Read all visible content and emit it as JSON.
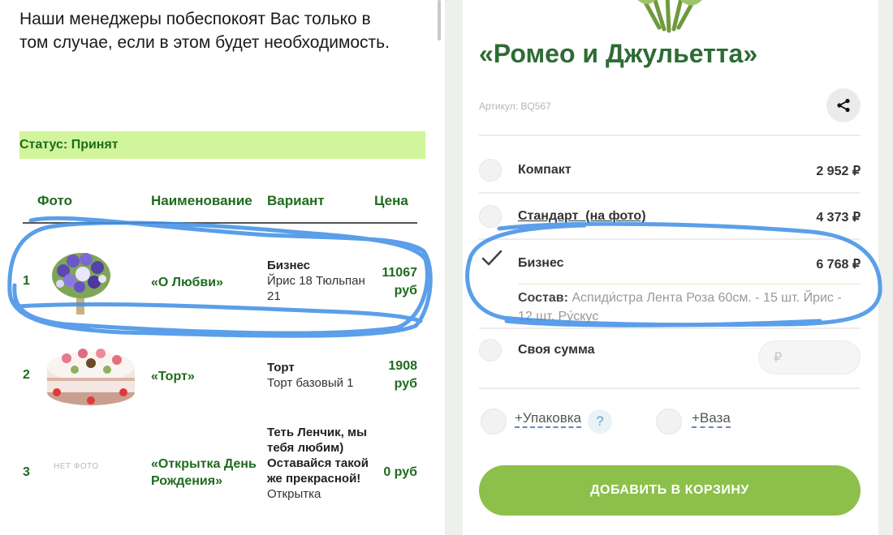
{
  "order": {
    "intro_lines": [
      "Наши менеджеры побеспокоят Вас только в",
      "том случае, если в этом будет необходимость."
    ],
    "status": "Статус: Принят",
    "columns": {
      "photo": "Фото",
      "name": "Наименование",
      "variant": "Вариант",
      "price": "Цена"
    },
    "items": [
      {
        "num": "1",
        "name": "«О Любви»",
        "variant_title": "Бизнес",
        "variant_detail": "Йрис 18 Тюльпан 21",
        "price_value": "11067",
        "price_unit": "руб",
        "photo": "flower-bouquet"
      },
      {
        "num": "2",
        "name": "«Торт»",
        "variant_title": "Торт",
        "variant_detail": "Торт базовый 1",
        "price_value": "1908",
        "price_unit": "руб",
        "photo": "cake"
      },
      {
        "num": "3",
        "name": "«Открытка День Рождения»",
        "variant_title": "Теть Ленчик, мы тебя любим) Оставайся такой же прекрасной!",
        "variant_detail": "Открытка",
        "price_value": "0 руб",
        "price_unit": "",
        "photo": "НЕТ ФОТО"
      }
    ]
  },
  "product": {
    "title": "«Ромео и Джульетта»",
    "sku": "Артикул: BQ567",
    "options": [
      {
        "label": "Компакт",
        "price": "2 952 ₽",
        "selected": false
      },
      {
        "label": "Стандарт  (на фото)",
        "price": "4 373 ₽",
        "selected": false
      },
      {
        "label": "Бизнес",
        "price": "6 768 ₽",
        "selected": true
      }
    ],
    "composition_label": "Состав:",
    "composition_text": "Аспиди́стра   Лента   Роза 60см. - 15 шт.   Йрис - 12 шт.   Ру́скус",
    "custom_sum_label": "Своя сумма",
    "custom_sum_placeholder": "₽",
    "addon_pack": "+Упаковка",
    "addon_help": "?",
    "addon_vase": "+Ваза",
    "add_to_cart": "ДОБАВИТЬ В КОРЗИНУ"
  },
  "colors": {
    "status_bg": "#d1f59b",
    "dark_green": "#1f6b1f",
    "title_green": "#2e6b35",
    "button_green": "#8cc04b",
    "annotation_blue": "#3f8ee6"
  }
}
